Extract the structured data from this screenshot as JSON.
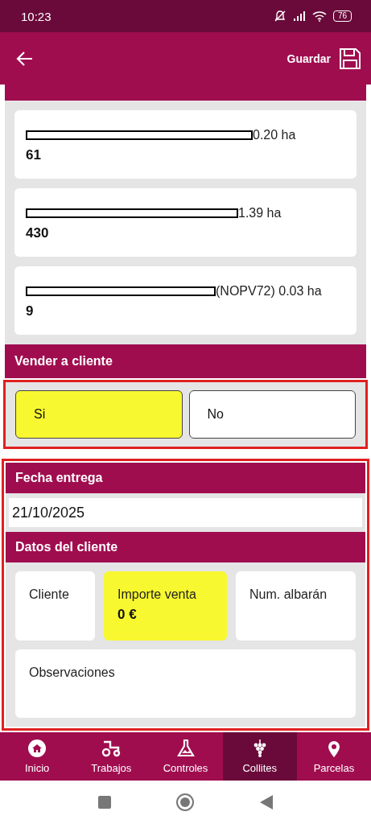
{
  "status_bar": {
    "time": "10:23",
    "battery": "76"
  },
  "app_bar": {
    "action": "Guardar"
  },
  "parcels": [
    {
      "suffix": "0.20 ha",
      "number": "61"
    },
    {
      "suffix": "1.39 ha",
      "number": "430"
    },
    {
      "suffix": "(NOPV72) 0.03 ha",
      "number": "9"
    }
  ],
  "sell_section": {
    "title": "Vender a cliente",
    "options": [
      {
        "label": "Si",
        "selected": true
      },
      {
        "label": "No",
        "selected": false
      }
    ]
  },
  "delivery": {
    "title": "Fecha entrega",
    "value": "21/10/2025"
  },
  "client_section": {
    "title": "Datos del cliente",
    "fields": [
      {
        "label": "Cliente",
        "highlighted": false
      },
      {
        "label": "Importe venta",
        "value": "0 €",
        "highlighted": true
      },
      {
        "label": "Num. albarán",
        "highlighted": false
      }
    ],
    "notes": {
      "label": "Observaciones"
    }
  },
  "bottom_nav": [
    {
      "label": "Inicio",
      "kind": "home",
      "selected": false
    },
    {
      "label": "Trabajos",
      "kind": "tractor",
      "selected": false
    },
    {
      "label": "Controles",
      "kind": "flask",
      "selected": false
    },
    {
      "label": "Collites",
      "kind": "grapes",
      "selected": true
    },
    {
      "label": "Parcelas",
      "kind": "pin",
      "selected": false
    }
  ]
}
